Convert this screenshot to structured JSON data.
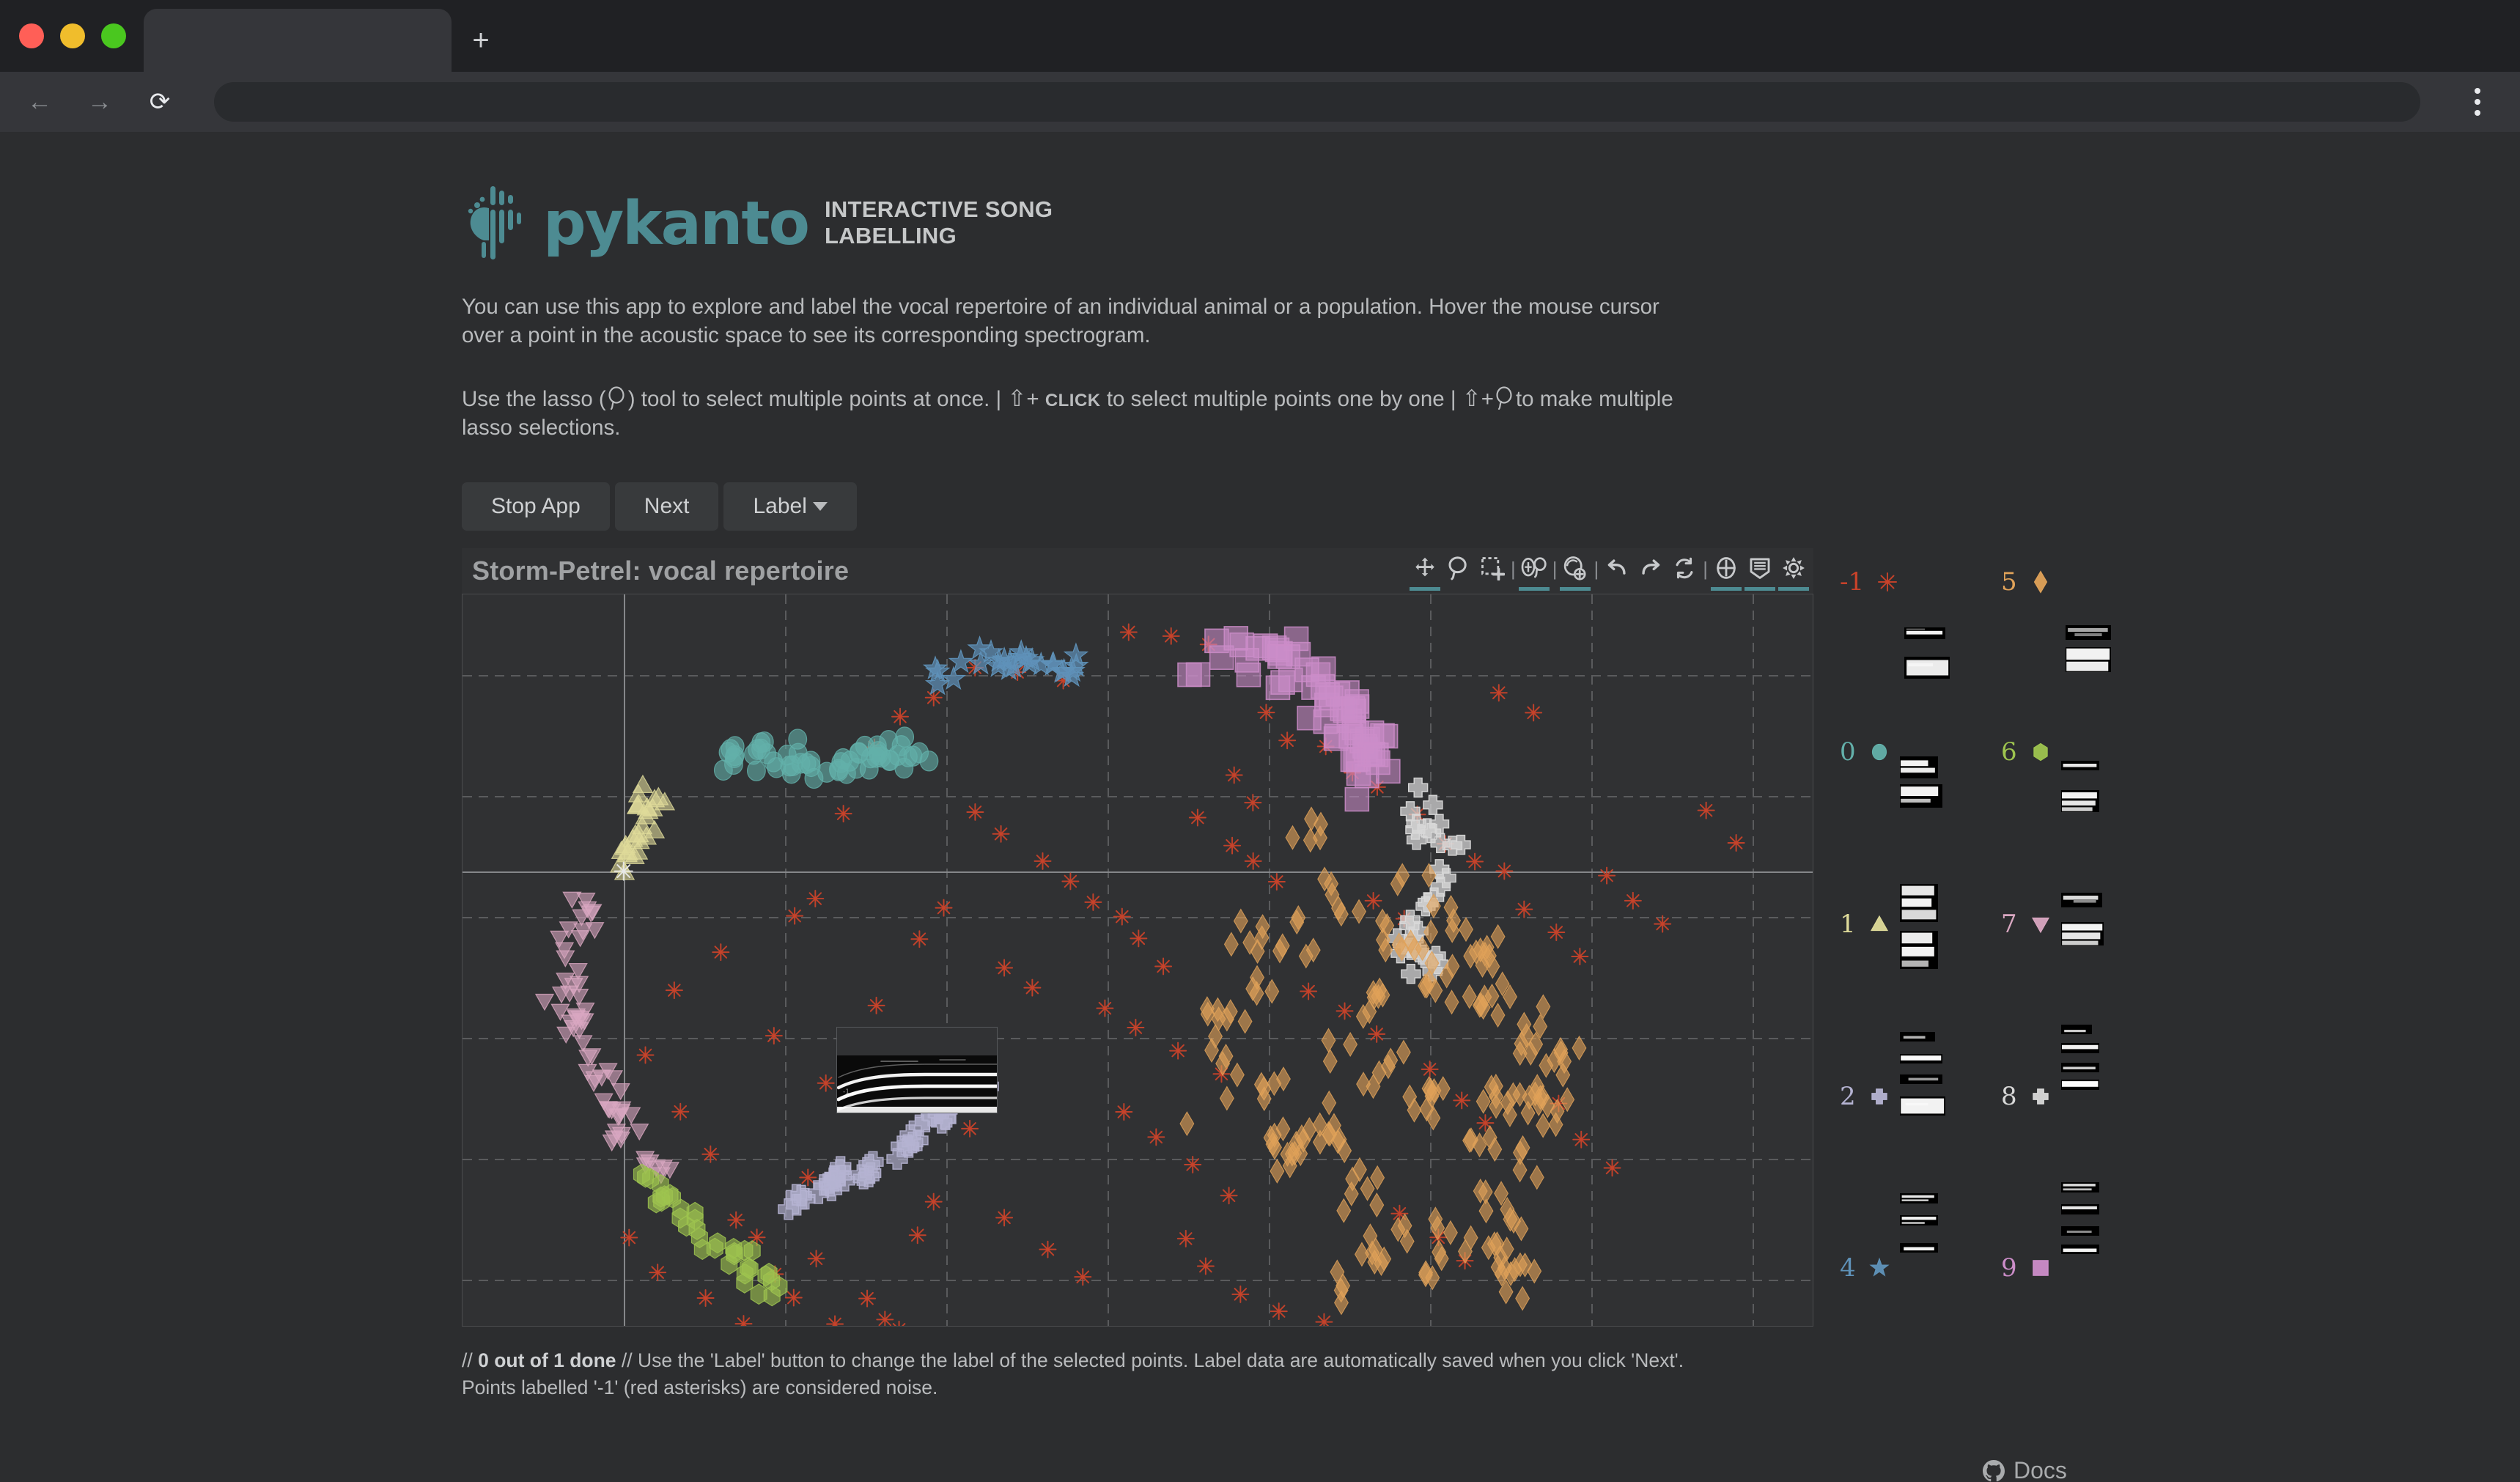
{
  "browser": {
    "tab_title": "",
    "url_value": "",
    "url_placeholder": "",
    "new_tab_label": "+",
    "back_icon": "back-arrow-icon",
    "forward_icon": "forward-arrow-icon",
    "reload_icon": "reload-icon",
    "menu_icon": "kebab-menu-icon"
  },
  "header": {
    "logo_word": "pykanto",
    "tagline_line1": "INTERACTIVE SONG",
    "tagline_line2": "LABELLING",
    "logo_color": "#4d8b92"
  },
  "intro": {
    "paragraph1": "You can use this app to explore and label the vocal repertoire of an individual animal or a population. Hover the mouse cursor over a point in the acoustic space to see its corresponding spectrogram.",
    "line2_a": "Use the lasso (",
    "line2_b": ") tool to select multiple points at once. |",
    "line2_shift": "⇧",
    "line2_plus": "+",
    "line2_click": "CLICK",
    "line2_c": "to select multiple points one by one |",
    "line2_shift2": "⇧",
    "line2_plus2": "+",
    "line2_d": "to make multiple lasso selections."
  },
  "buttons": {
    "stop_app": "Stop App",
    "next": "Next",
    "label": "Label"
  },
  "plot": {
    "title": "Storm-Petrel: vocal repertoire",
    "tools": [
      {
        "name": "pan-tool",
        "active": true
      },
      {
        "name": "lasso-select-tool",
        "active": false
      },
      {
        "name": "box-select-tool",
        "active": false
      },
      {
        "name": "tap-select-tool",
        "active": true
      },
      {
        "name": "zoom-in-tool",
        "active": true
      },
      {
        "name": "undo-tool",
        "active": false
      },
      {
        "name": "redo-tool",
        "active": false
      },
      {
        "name": "reset-tool",
        "active": false
      },
      {
        "name": "crosshair-tool",
        "active": true
      },
      {
        "name": "hover-tool",
        "active": true
      },
      {
        "name": "save-tool",
        "active": true
      }
    ]
  },
  "footer": {
    "progress_prefix": "//",
    "progress": "0 out of 1 done",
    "note_line1": "// Use the 'Label' button to change the label of the selected points. Label data are automatically saved when you click 'Next'.",
    "note_line2": "Points labelled '-1' (red asterisks) are considered noise.",
    "docs_label": "Docs",
    "docs_icon": "github-icon"
  },
  "chart_data": {
    "type": "scatter",
    "title": "Storm-Petrel: vocal repertoire",
    "xlabel": "",
    "ylabel": "",
    "grid": true,
    "legend_position": "right",
    "axis_lines": {
      "x_axis_y_frac": 0.375,
      "y_axis_x_frac": 0.119
    },
    "series": [
      {
        "name": "-1",
        "label": "-1",
        "marker": "asterisk",
        "color": "#c7422a",
        "count": 118,
        "description": "noise points scattered broadly through the centre and edges of the embedding"
      },
      {
        "name": "0",
        "label": "0",
        "marker": "circle",
        "color": "#63b0aa",
        "count": 52,
        "description": "teal circle cluster, upper-left-of-centre arc"
      },
      {
        "name": "1",
        "label": "1",
        "marker": "triangle",
        "color": "#dfdb9a",
        "count": 26,
        "description": "pale yellow triangles, upper middle-left"
      },
      {
        "name": "2",
        "label": "2",
        "marker": "cross",
        "color": "#b5b3d2",
        "count": 42,
        "description": "lavender crosses, lower centre rising to the right"
      },
      {
        "name": "4",
        "label": "4",
        "marker": "star",
        "color": "#5f92b9",
        "count": 26,
        "description": "blue stars, top centre-left"
      },
      {
        "name": "5",
        "label": "5",
        "marker": "diamond",
        "color": "#e0a259",
        "count": 230,
        "description": "large orange diamond cluster on the right half"
      },
      {
        "name": "6",
        "label": "6",
        "marker": "hexagon",
        "color": "#9ec44f",
        "count": 34,
        "description": "olive-green hexagons, bottom left"
      },
      {
        "name": "7",
        "label": "7",
        "marker": "inverted-triangle",
        "color": "#d9a7c1",
        "count": 62,
        "description": "pink inverted triangles, left side"
      },
      {
        "name": "8",
        "label": "8",
        "marker": "cross",
        "color": "#d8d8d8",
        "count": 30,
        "description": "white crosses, right of centre"
      },
      {
        "name": "9",
        "label": "9",
        "marker": "square",
        "color": "#cc8dc9",
        "count": 58,
        "description": "magenta squares, top right arc"
      }
    ],
    "legend_entries": [
      {
        "label": "-1",
        "color": "#c7422a",
        "marker": "asterisk"
      },
      {
        "label": "0",
        "color": "#63b0aa",
        "marker": "circle"
      },
      {
        "label": "1",
        "color": "#dfdb9a",
        "marker": "triangle"
      },
      {
        "label": "2",
        "color": "#b5b3d2",
        "marker": "cross"
      },
      {
        "label": "4",
        "color": "#5f92b9",
        "marker": "star"
      },
      {
        "label": "5",
        "color": "#e0a259",
        "marker": "diamond"
      },
      {
        "label": "6",
        "color": "#9ec44f",
        "marker": "hexagon"
      },
      {
        "label": "7",
        "color": "#d9a7c1",
        "marker": "inverted-triangle"
      },
      {
        "label": "8",
        "color": "#d8d8d8",
        "marker": "cross"
      },
      {
        "label": "9",
        "color": "#cc8dc9",
        "marker": "square"
      }
    ]
  }
}
